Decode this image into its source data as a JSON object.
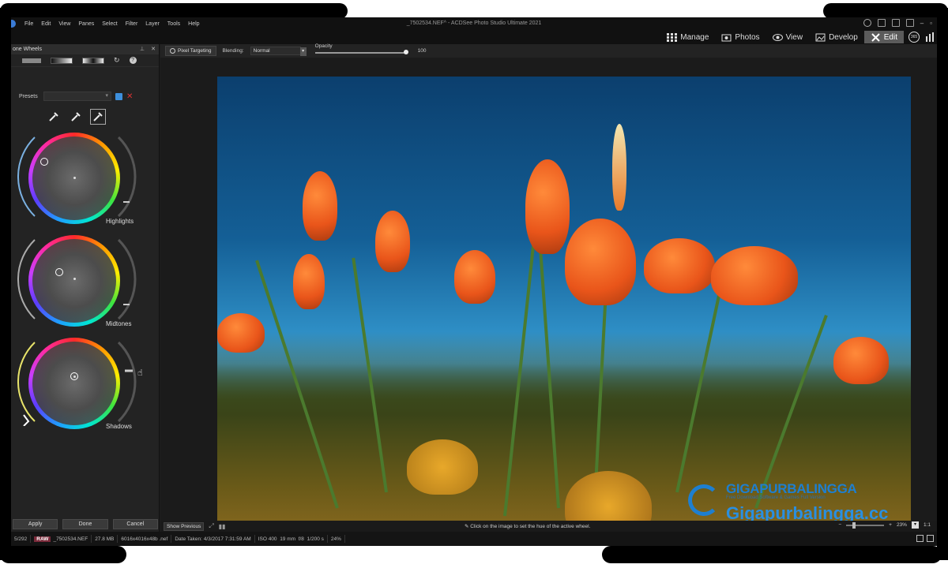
{
  "menu": [
    "File",
    "Edit",
    "View",
    "Panes",
    "Select",
    "Filter",
    "Layer",
    "Tools",
    "Help"
  ],
  "window_title": "_7502534.NEF^ - ACDSee Photo Studio Ultimate 2021",
  "modes": [
    {
      "label": "Manage",
      "icon": "grid-icon"
    },
    {
      "label": "Photos",
      "icon": "photos-icon"
    },
    {
      "label": "View",
      "icon": "eye-icon"
    },
    {
      "label": "Develop",
      "icon": "develop-icon"
    },
    {
      "label": "Edit",
      "icon": "edit-icon",
      "active": true
    }
  ],
  "mode_icons": [
    "365-icon",
    "stats-icon"
  ],
  "panel": {
    "title": "one Wheels",
    "presets_label": "Presets",
    "wheels": [
      {
        "label": "Highlights"
      },
      {
        "label": "Midtones"
      },
      {
        "label": "Shadows"
      }
    ],
    "buttons": {
      "apply": "Apply",
      "done": "Done",
      "cancel": "Cancel"
    }
  },
  "toolbar": {
    "pixel_targeting": "Pixel Targeting",
    "blending_label": "Blending:",
    "blending_value": "Normal",
    "opacity_label": "Opacity",
    "opacity_value": "100"
  },
  "watermark": {
    "brand": "GIGAPURBALINGGA",
    "tagline": "Free Download Software & Games Full Version",
    "url": "Gigapurbalingga.cc"
  },
  "bottom": {
    "show_previous": "Show Previous",
    "hint": "Click on the image to set the hue of the active wheel.",
    "zoom": "23%",
    "ratio": "1:1"
  },
  "status": {
    "count": "5/292",
    "raw": "RAW",
    "filename": "_7502534.NEF",
    "size": "27.8 MB",
    "dimensions": "6016x4016x48b .nef",
    "date": "Date Taken: 4/3/2017 7:31:59 AM",
    "iso": "ISO 400",
    "focal": "19 mm",
    "aperture": "f/8",
    "shutter": "1/200 s",
    "zoom": "24%"
  }
}
